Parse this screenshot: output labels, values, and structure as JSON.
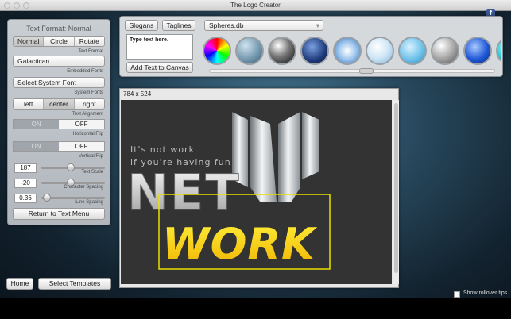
{
  "window": {
    "title": "The Logo Creator"
  },
  "panel": {
    "title": "Text Format: Normal",
    "format_tabs": [
      "Normal",
      "Circle",
      "Rotate"
    ],
    "format_caption": "Text Format",
    "embedded_font": "Galactican",
    "embedded_caption": "Embedded Fonts",
    "system_font": "Select System Font",
    "system_caption": "System Fonts",
    "align_tabs": [
      "left",
      "center",
      "right"
    ],
    "align_caption": "Text Alignment",
    "hflip": {
      "on": "ON",
      "off": "OFF",
      "caption": "Horizontal Flip"
    },
    "vflip": {
      "on": "ON",
      "off": "OFF",
      "caption": "Vertical Flip"
    },
    "text_scale": {
      "value": "187",
      "caption": "Text Scale",
      "level": 0.45
    },
    "char_spacing": {
      "value": "-20",
      "caption": "Character Spacing",
      "level": 0.45
    },
    "line_spacing": {
      "value": "0.36",
      "caption": "Line Spacing",
      "level": 0.03
    },
    "return_button": "Return to Text Menu"
  },
  "top": {
    "slogans_tab": "Slogans",
    "taglines_tab": "Taglines",
    "library": "Spheres.db",
    "text_placeholder": "Type text here.",
    "add_button": "Add Text to Canvas",
    "spheres": [
      "rainbow-sphere",
      "steel-blue-sphere",
      "chrome-sphere",
      "grid-sphere",
      "ice-sphere",
      "glass-sphere",
      "aqua-sphere",
      "silver-sphere",
      "blue-sphere",
      "cyan-sphere"
    ]
  },
  "canvas": {
    "size_label": "784 x 524",
    "tagline_1": "It's not work",
    "tagline_2": "if you're having fun",
    "word_net": "NET",
    "word_work": "WORK"
  },
  "bottom": {
    "home": "Home",
    "templates": "Select Templates",
    "rollover": "Show rollover tips"
  }
}
